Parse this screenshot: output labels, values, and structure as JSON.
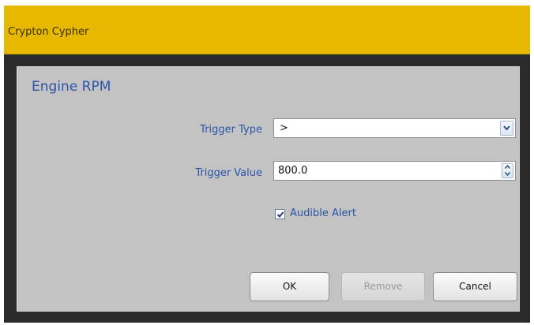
{
  "window": {
    "title": "Crypton Cypher"
  },
  "panel": {
    "title": "Engine RPM"
  },
  "form": {
    "trigger_type_label": "Trigger Type",
    "trigger_type_value": ">",
    "trigger_value_label": "Trigger Value",
    "trigger_value_value": "800.0",
    "audible_alert_label": "Audible Alert",
    "audible_alert_checked": true
  },
  "buttons": {
    "ok_label": "OK",
    "remove_label": "Remove",
    "remove_enabled": false,
    "cancel_label": "Cancel"
  },
  "colors": {
    "titlebar": "#e6b800",
    "label_text": "#2a55a8",
    "panel_bg": "#c3c3c3",
    "frame_bg": "#2b2b2b"
  },
  "icons": {
    "dropdown": "chevron-down-icon",
    "spin_up": "chevron-up-icon",
    "spin_down": "chevron-down-icon",
    "checkbox": "checkmark-icon"
  }
}
